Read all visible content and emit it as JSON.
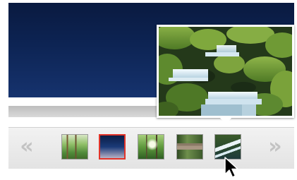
{
  "viewer": {
    "main_image": "dark-blue-ocean-photo",
    "accent_color": "#e2342a"
  },
  "filmstrip": {
    "prev_icon": "double-chevron-left-icon",
    "next_icon": "double-chevron-right-icon",
    "prev_glyph": "«",
    "next_glyph": "»",
    "thumbnails": [
      {
        "name": "forest-trees-photo",
        "selected": false
      },
      {
        "name": "blue-ocean-photo",
        "selected": true
      },
      {
        "name": "sunlit-forest-photo",
        "selected": false
      },
      {
        "name": "cabin-in-woods-photo",
        "selected": false
      },
      {
        "name": "mossy-waterfall-stream-photo",
        "selected": false,
        "hovered": true
      }
    ]
  },
  "preview": {
    "image": "mossy-waterfall-stream-photo"
  },
  "cursor": {
    "type": "arrow-pointer"
  }
}
